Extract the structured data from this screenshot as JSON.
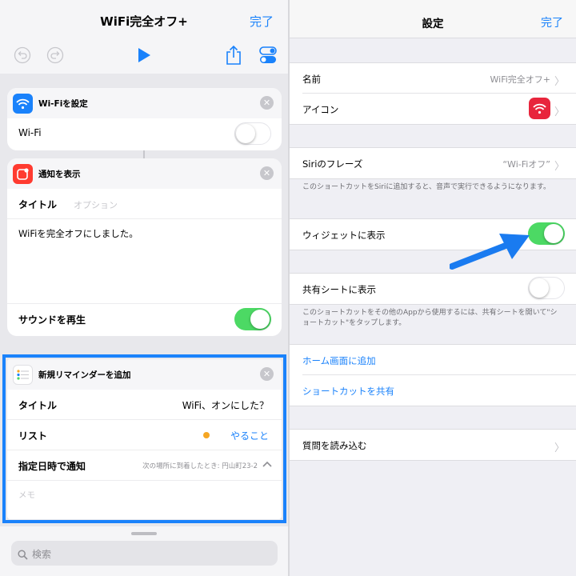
{
  "left": {
    "nav": {
      "title": "WiFi完全オフ+",
      "done": "完了"
    },
    "toolbar": {
      "undo_icon": "undo-icon",
      "redo_icon": "redo-icon",
      "play_icon": "play-icon",
      "share_icon": "share-icon",
      "settings_icon": "toggles-icon"
    },
    "wifi_card": {
      "title": "Wi-Fiを設定",
      "row_label": "Wi-Fi",
      "toggle": "off"
    },
    "notify_card": {
      "title": "通知を表示",
      "title_label": "タイトル",
      "title_placeholder": "オプション",
      "body": "WiFiを完全オフにしました。",
      "sound_label": "サウンドを再生",
      "sound_toggle": "on"
    },
    "reminder_card": {
      "title": "新規リマインダーを追加",
      "rows": [
        {
          "label": "タイトル",
          "value": "WiFi、オンにした？"
        },
        {
          "label": "リスト",
          "value": "やること"
        },
        {
          "label": "指定日時で通知",
          "value": "次の場所に到着したとき: 円山町23-2"
        }
      ],
      "memo_placeholder": "メモ"
    },
    "search": {
      "placeholder": "検索"
    }
  },
  "right": {
    "nav": {
      "title": "設定",
      "done": "完了"
    },
    "name": {
      "label": "名前",
      "value": "WiFi完全オフ+"
    },
    "icon_row": {
      "label": "アイコン"
    },
    "siri": {
      "label": "Siriのフレーズ",
      "value": "“Wi-Fiオフ”"
    },
    "siri_note": "このショートカットをSiriに追加すると、音声で実行できるようになります。",
    "widget": {
      "label": "ウィジェットに表示",
      "toggle": "on"
    },
    "share_sheet": {
      "label": "共有シートに表示",
      "toggle": "off"
    },
    "share_note": "このショートカットをその他のAppから使用するには、共有シートを開いて\"ショートカット\"をタップします。",
    "links": {
      "home": "ホーム画面に追加",
      "share": "ショートカットを共有"
    },
    "import": {
      "label": "質問を読み込む"
    }
  },
  "colors": {
    "accent": "#1a82fb",
    "toggle_on": "#4cd964",
    "reminder_orange": "#f5a623",
    "notify_red": "#ff3b30",
    "icon_red": "#e8253c"
  }
}
